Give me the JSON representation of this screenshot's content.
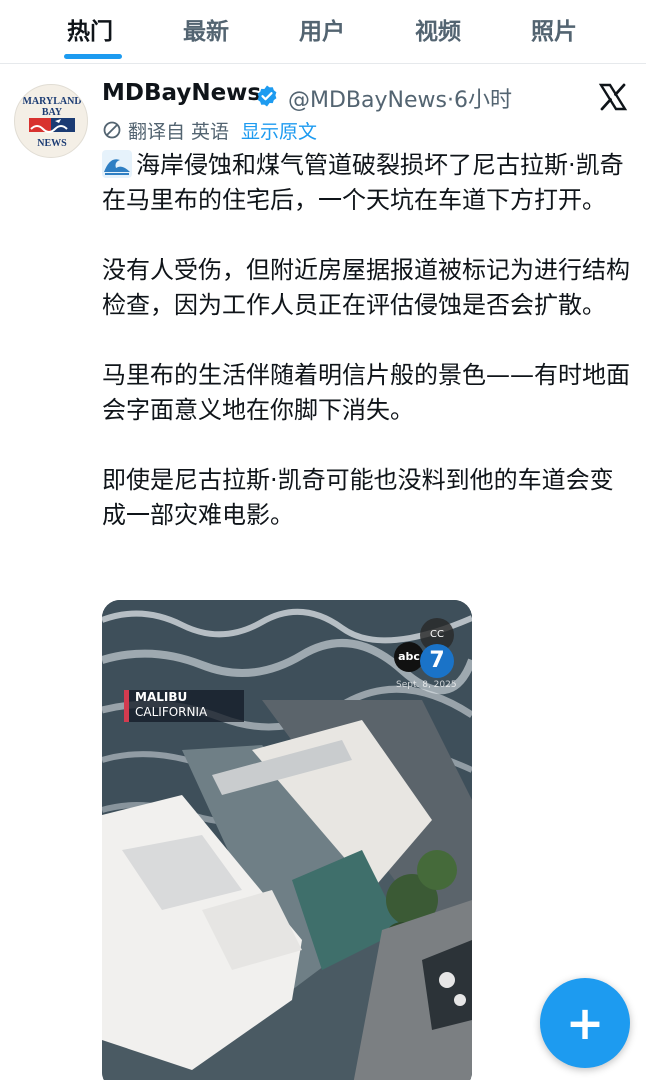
{
  "tabs": [
    {
      "label": "热门",
      "active": true
    },
    {
      "label": "最新",
      "active": false
    },
    {
      "label": "用户",
      "active": false
    },
    {
      "label": "视频",
      "active": false
    },
    {
      "label": "照片",
      "active": false
    }
  ],
  "tweet": {
    "avatar": {
      "line1": "MARYLAND",
      "line2": "BAY",
      "line3": "NEWS",
      "icon": "maryland-bay-news-logo"
    },
    "display_name": "MDBayNews",
    "handle_time": "@MDBayNews·6小时",
    "verified_icon": "verified-badge-icon",
    "platform_icon": "x-logo-icon",
    "translated_label": "翻译自 英语",
    "show_original": "显示原文",
    "paragraphs": [
      "海岸侵蚀和煤气管道破裂损坏了尼古拉斯·凯奇在马里布的住宅后，一个天坑在车道下方打开。",
      "没有人受伤，但附近房屋据报道被标记为进行结构检查，因为工作人员正在评估侵蚀是否会扩散。",
      "马里布的生活伴随着明信片般的景色——有时地面会字面意义地在你脚下消失。",
      "即使是尼古拉斯·凯奇可能也没料到他的车道会变成一部灾难电影。"
    ],
    "media": {
      "location_city": "MALIBU",
      "location_state": "CALIFORNIA",
      "network_logo": "abc",
      "channel": "7",
      "cc_label": "CC",
      "date": "Sept. 8, 2025"
    }
  },
  "fab": {
    "label": "+"
  },
  "colors": {
    "accent": "#1d9bf0",
    "text": "#0f1419",
    "muted": "#536471"
  }
}
